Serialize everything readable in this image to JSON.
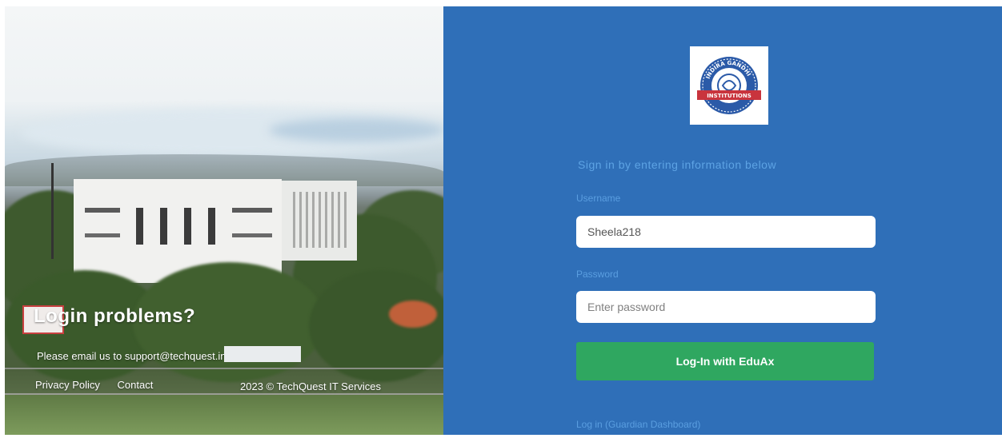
{
  "left_panel": {
    "heading": "Login problems?",
    "support_text": "Please email us to support@techquest.in",
    "footer_links": [
      "Privacy Policy",
      "Contact"
    ],
    "copyright": "2023 © TechQuest IT Services"
  },
  "right_panel": {
    "logo": {
      "name": "institution-seal-logo",
      "seal_text": "INDIRA GANDHI",
      "ribbon_text": "INSTITUTIONS"
    },
    "subtitle": "Sign in by entering information below",
    "username_label": "Username",
    "username_value": "Sheela218",
    "password_label": "Password",
    "password_placeholder": "Enter password",
    "submit_label": "Log-In with EduAx",
    "bottom_link": "Log in (Guardian Dashboard)"
  },
  "colors": {
    "panel_blue": "#2f6fb8",
    "label_blue": "#5a9ee0",
    "button_green": "#2fa760"
  }
}
